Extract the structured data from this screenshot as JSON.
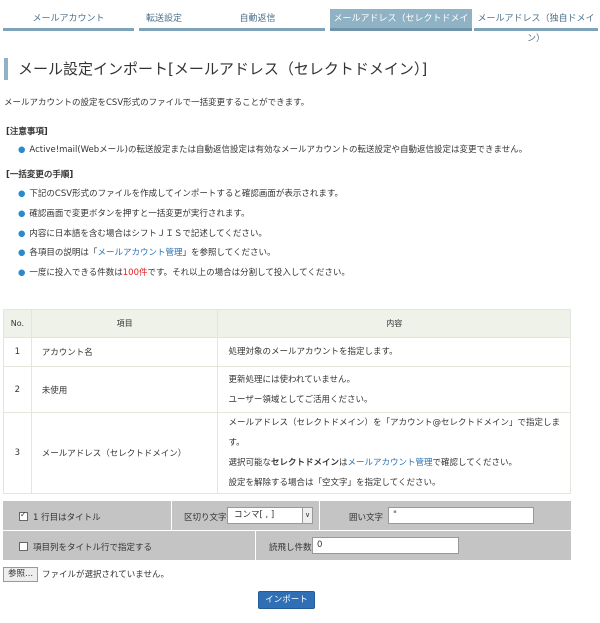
{
  "tabs": [
    {
      "label": "メールアカウント"
    },
    {
      "label": "転送設定"
    },
    {
      "label": "自動返信"
    },
    {
      "label": "メールアドレス（セレクトドメイン）"
    },
    {
      "label": "メールアドレス（独自ドメイン）"
    }
  ],
  "page_title": "メール設定インポート[メールアドレス（セレクトドメイン）]",
  "intro": "メールアカウントの設定をCSV形式のファイルで一括変更することができます。",
  "notice": {
    "heading": "[注意事項]",
    "items": [
      "Active!mail(Webメール)の転送設定または自動返信設定は有効なメールアカウントの転送設定や自動返信設定は変更できません。"
    ]
  },
  "steps": {
    "heading": "[一括変更の手順]",
    "items": [
      "下記のCSV形式のファイルを作成してインポートすると確認画面が表示されます。",
      "確認画面で変更ボタンを押すと一括変更が実行されます。",
      "内容に日本語を含む場合はシフトＪＩＳで記述してください。"
    ],
    "item4_prefix": "各項目の説明は「",
    "item4_link": "メールアカウント管理",
    "item4_suffix": "」を参照してください。",
    "item5_prefix": "一度に投入できる件数は",
    "item5_red": "100件",
    "item5_suffix": "です。それ以上の場合は分割して投入してください。"
  },
  "table": {
    "headers": {
      "no": "No.",
      "item": "項目",
      "content": "内容"
    },
    "rows": [
      {
        "no": "1",
        "item": "アカウント名",
        "content": [
          "処理対象のメールアカウントを指定します。"
        ]
      },
      {
        "no": "2",
        "item": "未使用",
        "content": [
          "更新処理には使われていません。",
          "ユーザー領域としてご活用ください。"
        ]
      },
      {
        "no": "3",
        "item": "メールアドレス（セレクトドメイン）",
        "content_line1": "メールアドレス（セレクトドメイン）を「アカウント@セレクトドメイン」で指定しま",
        "content_line2": "す。",
        "content_line3_a": "選択可能な",
        "content_line3_bold": "セレクトドメイン",
        "content_line3_b": "は",
        "content_line3_link": "メールアカウント管理",
        "content_line3_c": "で確認してください。",
        "content_line4": "設定を解除する場合は「空文字」を指定してください。"
      }
    ]
  },
  "settings": {
    "first_row_title_label": "1 行目はタイトル",
    "first_row_title_checked": true,
    "delimiter_label": "区切り文字",
    "delimiter_value": "コンマ[ , ]",
    "quote_label": "囲い文字",
    "quote_value": "\"",
    "column_title_label": "項目列をタイトル行で指定する",
    "column_title_checked": false,
    "skip_label": "読飛し件数",
    "skip_value": "0"
  },
  "file": {
    "browse_label": "参照...",
    "status": "ファイルが選択されていません。"
  },
  "import_button": "インポート"
}
